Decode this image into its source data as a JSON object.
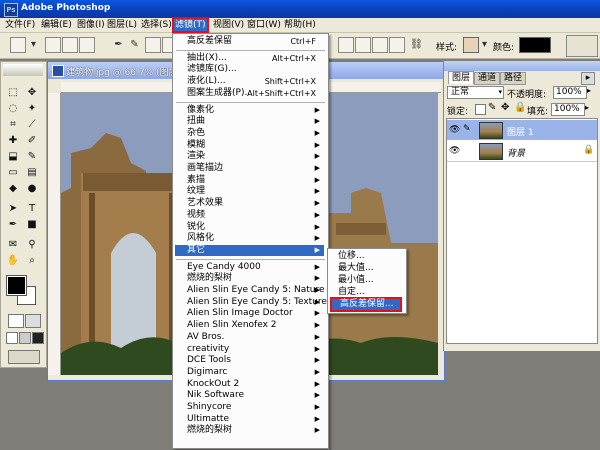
{
  "app": {
    "title": "Adobe Photoshop"
  },
  "menubar": [
    "文件(F)",
    "编辑(E)",
    "图像(I)",
    "图层(L)",
    "选择(S)",
    "滤镜(T)",
    "视图(V)",
    "窗口(W)",
    "帮助(H)"
  ],
  "options": {
    "style_label": "样式:",
    "color_label": "颜色:",
    "swatch_color": "#e8d2b8",
    "color_value": "#000000"
  },
  "document": {
    "title": "建筑物.jpg @ 66.7% (图层"
  },
  "panel": {
    "tabs": [
      "图层",
      "通道",
      "路径"
    ],
    "blend_mode": "正常",
    "opacity_label": "不透明度:",
    "opacity_value": "100%",
    "lock_label": "锁定:",
    "fill_label": "填充:",
    "fill_value": "100%",
    "layers": [
      {
        "name": "图层 1",
        "selected": true
      },
      {
        "name": "背景",
        "selected": false
      }
    ]
  },
  "filter_menu": {
    "items": [
      {
        "label": "高反差保留",
        "shortcut": "Ctrl+F"
      },
      {
        "sep": true
      },
      {
        "label": "抽出(X)...",
        "shortcut": "Alt+Ctrl+X"
      },
      {
        "label": "滤镜库(G)..."
      },
      {
        "label": "液化(L)...",
        "shortcut": "Shift+Ctrl+X"
      },
      {
        "label": "图案生成器(P)...",
        "shortcut": "Alt+Shift+Ctrl+X"
      },
      {
        "sep": true
      },
      {
        "label": "像素化",
        "sub": true
      },
      {
        "label": "扭曲",
        "sub": true
      },
      {
        "label": "杂色",
        "sub": true
      },
      {
        "label": "模糊",
        "sub": true
      },
      {
        "label": "渲染",
        "sub": true
      },
      {
        "label": "画笔描边",
        "sub": true
      },
      {
        "label": "素描",
        "sub": true
      },
      {
        "label": "纹理",
        "sub": true
      },
      {
        "label": "艺术效果",
        "sub": true
      },
      {
        "label": "视频",
        "sub": true
      },
      {
        "label": "锐化",
        "sub": true
      },
      {
        "label": "风格化",
        "sub": true
      },
      {
        "label": "其它",
        "sub": true,
        "highlight": true
      },
      {
        "sep": true
      },
      {
        "label": "Eye Candy 4000",
        "sub": true
      },
      {
        "label": "燃烧的梨树",
        "sub": true
      },
      {
        "label": "Alien Slin Eye Candy 5: Nature",
        "sub": true
      },
      {
        "label": "Alien Slin Eye Candy 5: Textures",
        "sub": true
      },
      {
        "label": "Alien Slin Image Doctor",
        "sub": true
      },
      {
        "label": "Alien Slin Xenofex 2",
        "sub": true
      },
      {
        "label": "AV Bros.",
        "sub": true
      },
      {
        "label": "creativity",
        "sub": true
      },
      {
        "label": "DCE Tools",
        "sub": true
      },
      {
        "label": "Digimarc",
        "sub": true
      },
      {
        "label": "KnockOut 2",
        "sub": true
      },
      {
        "label": "Nik Software",
        "sub": true
      },
      {
        "label": "Shinycore",
        "sub": true
      },
      {
        "label": "Ultimatte",
        "sub": true
      },
      {
        "label": "燃烧的梨树",
        "sub": true
      }
    ]
  },
  "other_submenu": {
    "items": [
      "位移...",
      "最大值...",
      "最小值...",
      "自定...",
      "高反差保留..."
    ]
  }
}
